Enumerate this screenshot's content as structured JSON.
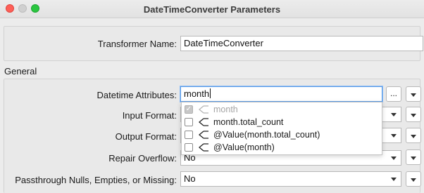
{
  "window": {
    "title": "DateTimeConverter Parameters"
  },
  "transformer": {
    "label": "Transformer Name:",
    "value": "DateTimeConverter"
  },
  "general": {
    "section_title": "General",
    "datetime_attributes": {
      "label": "Datetime Attributes:",
      "value": "month",
      "ellipsis": "..."
    },
    "input_format": {
      "label": "Input Format:"
    },
    "output_format": {
      "label": "Output Format:"
    },
    "repair_overflow": {
      "label": "Repair Overflow:",
      "value": "No"
    },
    "passthrough": {
      "label": "Passthrough Nulls, Empties, or Missing:",
      "value": "No"
    }
  },
  "attribute_popup": {
    "options": [
      {
        "label": "month",
        "checked": true,
        "disabled": true
      },
      {
        "label": "month.total_count",
        "checked": false,
        "disabled": false
      },
      {
        "label": "@Value(month.total_count)",
        "checked": false,
        "disabled": false
      },
      {
        "label": "@Value(month)",
        "checked": false,
        "disabled": false
      }
    ]
  },
  "icons": {
    "attribute": "attribute-icon",
    "dropdown": "chevron-down-icon",
    "check": "checkmark-icon"
  }
}
